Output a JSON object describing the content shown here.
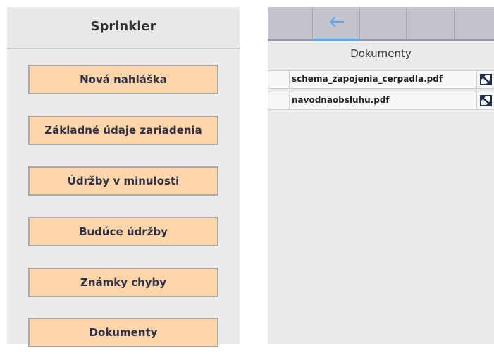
{
  "left_panel": {
    "title": "Sprinkler",
    "menu": [
      {
        "label": "Nová nahláška"
      },
      {
        "label": "Základné údaje zariadenia"
      },
      {
        "label": "Údržby v minulosti"
      },
      {
        "label": "Budúce údržby"
      },
      {
        "label": "Známky chyby"
      },
      {
        "label": "Dokumenty"
      }
    ]
  },
  "right_panel": {
    "title": "Dokumenty",
    "toolbar": {
      "back_icon": "arrow-left-icon"
    },
    "documents": [
      {
        "name": "schema_zapojenia_cerpadla.pdf",
        "action_icon": "open-external-icon"
      },
      {
        "name": "navodnaobsluhu.pdf",
        "action_icon": "open-external-icon"
      }
    ]
  },
  "colors": {
    "button_bg": "#ffd6a8",
    "button_border": "#a9a9a9",
    "toolbar_bg": "#c3c3cc",
    "accent_blue": "#5aa8f0",
    "panel_bg": "#ebebeb"
  }
}
